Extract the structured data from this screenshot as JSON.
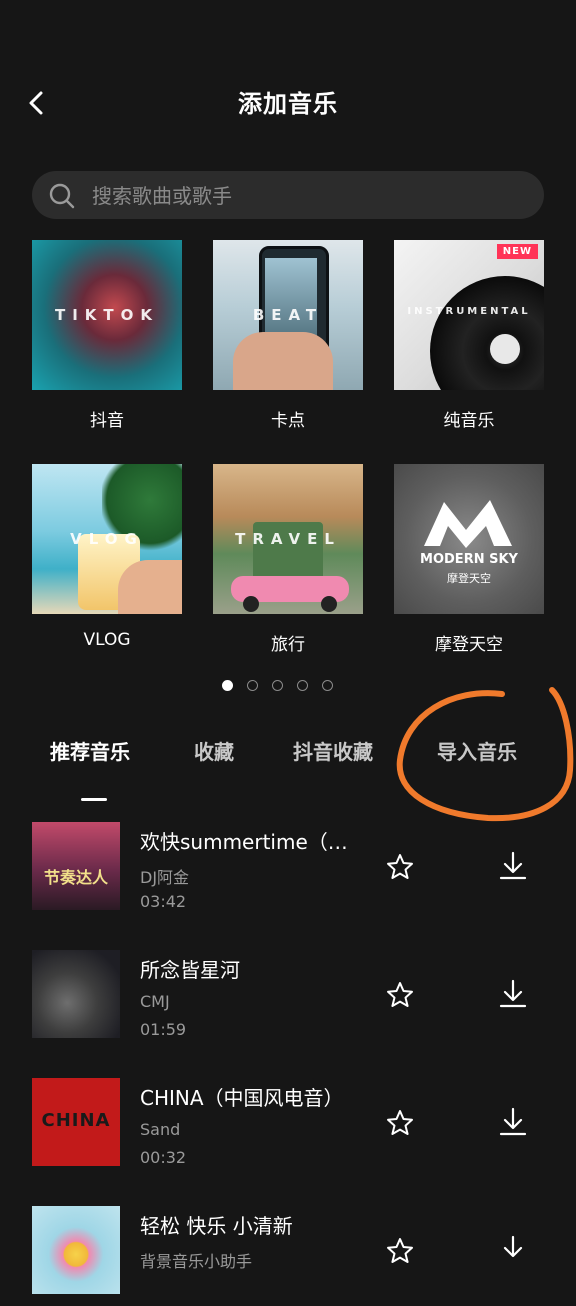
{
  "header": {
    "title": "添加音乐"
  },
  "search": {
    "placeholder": "搜索歌曲或歌手"
  },
  "categories": [
    {
      "label": "抖音",
      "thumb_text": "TIKTOK"
    },
    {
      "label": "卡点",
      "thumb_text": "BEAT"
    },
    {
      "label": "纯音乐",
      "thumb_text": "INSTRUMENTAL",
      "badge": "NEW"
    },
    {
      "label": "VLOG",
      "thumb_text": "VLOG"
    },
    {
      "label": "旅行",
      "thumb_text": "TRAVEL"
    },
    {
      "label": "摩登天空",
      "thumb_text": "MODERN SKY",
      "thumb_subtext": "摩登天空"
    }
  ],
  "pager": {
    "active_index": 0,
    "count": 5
  },
  "tabs": [
    {
      "label": "推荐音乐",
      "active": true
    },
    {
      "label": "收藏",
      "active": false
    },
    {
      "label": "抖音收藏",
      "active": false
    },
    {
      "label": "导入音乐",
      "active": false,
      "highlighted": true
    }
  ],
  "songs": [
    {
      "title": "欢快summertime（…",
      "artist": "DJ阿金",
      "duration": "03:42",
      "cover_text": "节奏达人"
    },
    {
      "title": "所念皆星河",
      "artist": "CMJ",
      "duration": "01:59"
    },
    {
      "title": "CHINA（中国风电音）",
      "artist": "Sand",
      "duration": "00:32",
      "cover_text": "CHINA"
    },
    {
      "title": "轻松 快乐 小清新",
      "artist": "背景音乐小助手",
      "duration": ""
    }
  ],
  "colors": {
    "background": "#161616",
    "search_bg": "#2c2c2c",
    "annotation": "#f07a2c",
    "badge": "#ff3357"
  }
}
